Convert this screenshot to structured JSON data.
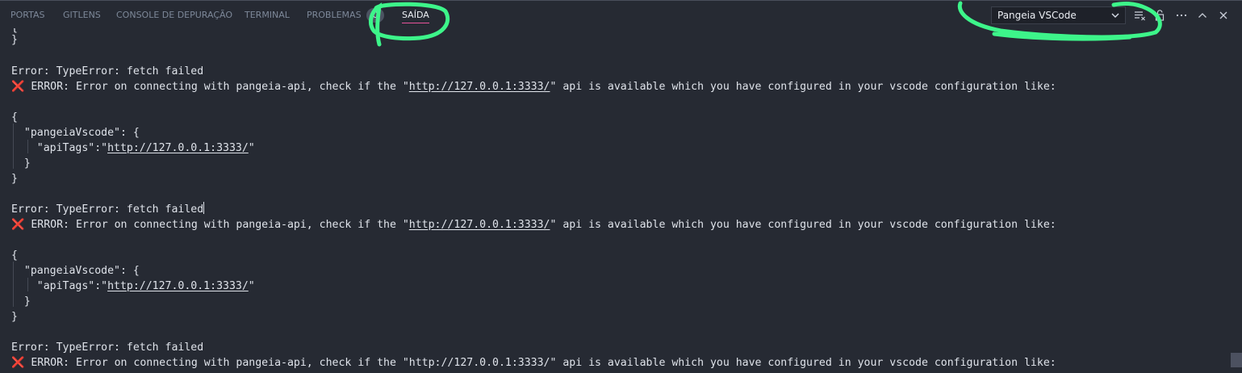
{
  "tabs": [
    {
      "label": "PORTAS"
    },
    {
      "label": "GITLENS"
    },
    {
      "label": "CONSOLE DE DEPURAÇÃO"
    },
    {
      "label": "TERMINAL"
    },
    {
      "label": "PROBLEMAS"
    },
    {
      "label": "SAÍDA"
    }
  ],
  "problems_count": "0",
  "output_channel": "Pangeia VSCode",
  "actions": [
    "clear-output-icon",
    "lock-icon",
    "more-actions-icon",
    "maximize-panel-icon",
    "close-panel-icon"
  ],
  "colors": {
    "background": "#262a33",
    "active_tab_underline": "#e6539b",
    "error_icon": "#f04b4b",
    "annotation_highlight": "#3df58a"
  },
  "output": {
    "brace_close": "}",
    "brace_open": "{",
    "error_fetch": "Error: TypeError: fetch failed",
    "error_prefix": " ERROR: Error on connecting with pangeia-api, check if the \"",
    "url": "http://127.0.0.1:3333/",
    "error_suffix": "\" api is available which you have configured in your vscode configuration like:",
    "config_key_line": "  \"pangeiaVscode\": {",
    "api_tags_prefix": "    \"apiTags\":\"",
    "api_tags_suffix": "\"",
    "inner_brace_close": "  }",
    "error_icon": "❌"
  }
}
